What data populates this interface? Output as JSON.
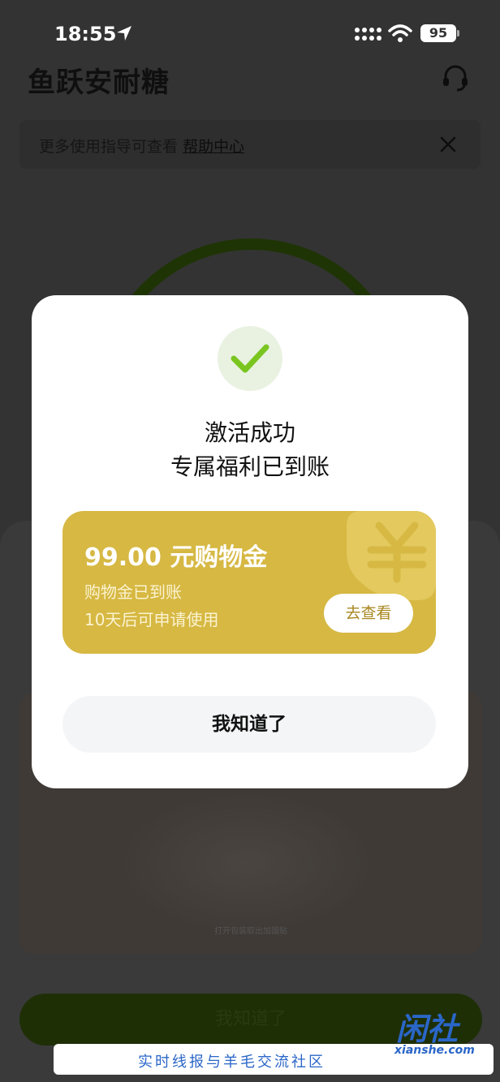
{
  "status_bar": {
    "time": "18:55",
    "battery": "95"
  },
  "app": {
    "title": "鱼跃安耐糖",
    "help_bar": {
      "text": "更多使用指导可查看",
      "link": "帮助中心"
    },
    "sheet_caption": "打开包装取出加固贴",
    "bottom_button": "我知道了"
  },
  "modal": {
    "title": "激活成功",
    "subtitle": "专属福利已到账",
    "coupon": {
      "amount": "99.00 元购物金",
      "line1": "购物金已到账",
      "line2": "10天后可申请使用",
      "button": "去查看"
    },
    "ok_button": "我知道了"
  },
  "watermark": {
    "logo": "闲社",
    "domain": "xianshe.com",
    "tagline": "实时线报与羊毛交流社区"
  },
  "colors": {
    "accent_green": "#7ac520",
    "coupon_gold": "#d6b843",
    "watermark_blue": "#2a66c8"
  }
}
